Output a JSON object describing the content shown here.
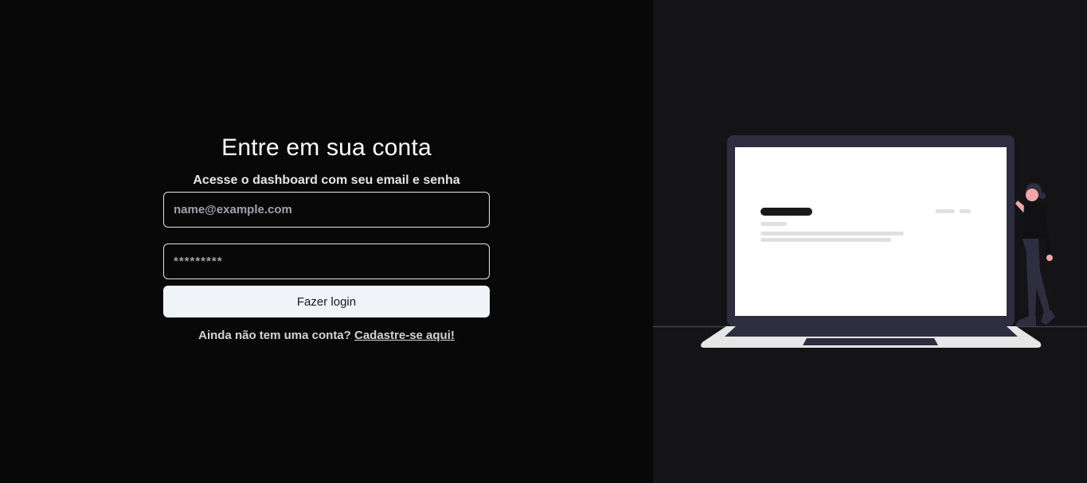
{
  "login": {
    "title": "Entre em sua conta",
    "subtitle": "Acesse o dashboard com seu email e senha",
    "email_placeholder": "name@example.com",
    "password_placeholder": "*********",
    "submit_label": "Fazer login",
    "signup_prompt": "Ainda não tem uma conta?",
    "signup_link": "Cadastre-se aqui!"
  },
  "colors": {
    "left_background": "#080809",
    "right_background": "#141416",
    "button_background": "#f0f3f8",
    "laptop_frame": "#2f2e41"
  }
}
